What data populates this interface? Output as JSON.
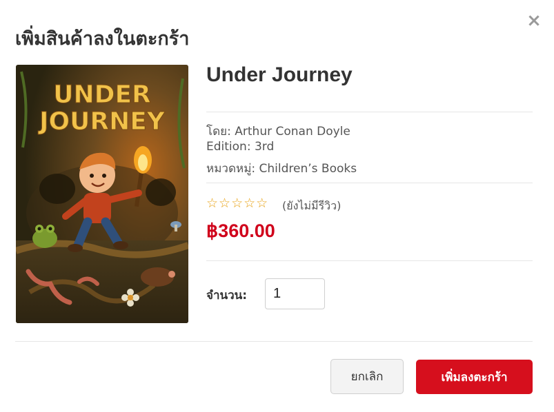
{
  "modal": {
    "title": "เพิ่มสินค้าลงในตะกร้า",
    "close_symbol": "×"
  },
  "product": {
    "cover_title_line1": "UNDER",
    "cover_title_line2": "JOURNEY",
    "title": "Under Journey",
    "author_line": "โดย: Arthur Conan Doyle",
    "edition_line": "Edition: 3rd",
    "category_line": "หมวดหมู่: Children’s Books",
    "stars": "☆☆☆☆☆",
    "rating": 0,
    "review_note": "(ยังไม่มีรีวิว)",
    "price": "฿360.00"
  },
  "quantity": {
    "label": "จำนวน:",
    "value": "1"
  },
  "buttons": {
    "cancel_label": "ยกเลิก",
    "add_label": "เพิ่มลงตะกร้า"
  },
  "colors": {
    "price": "#d0021b",
    "primary_button": "#d60f1d",
    "stars": "#e8a317"
  },
  "icons": {
    "close": "close-icon",
    "rating": "star-outline-icon"
  }
}
